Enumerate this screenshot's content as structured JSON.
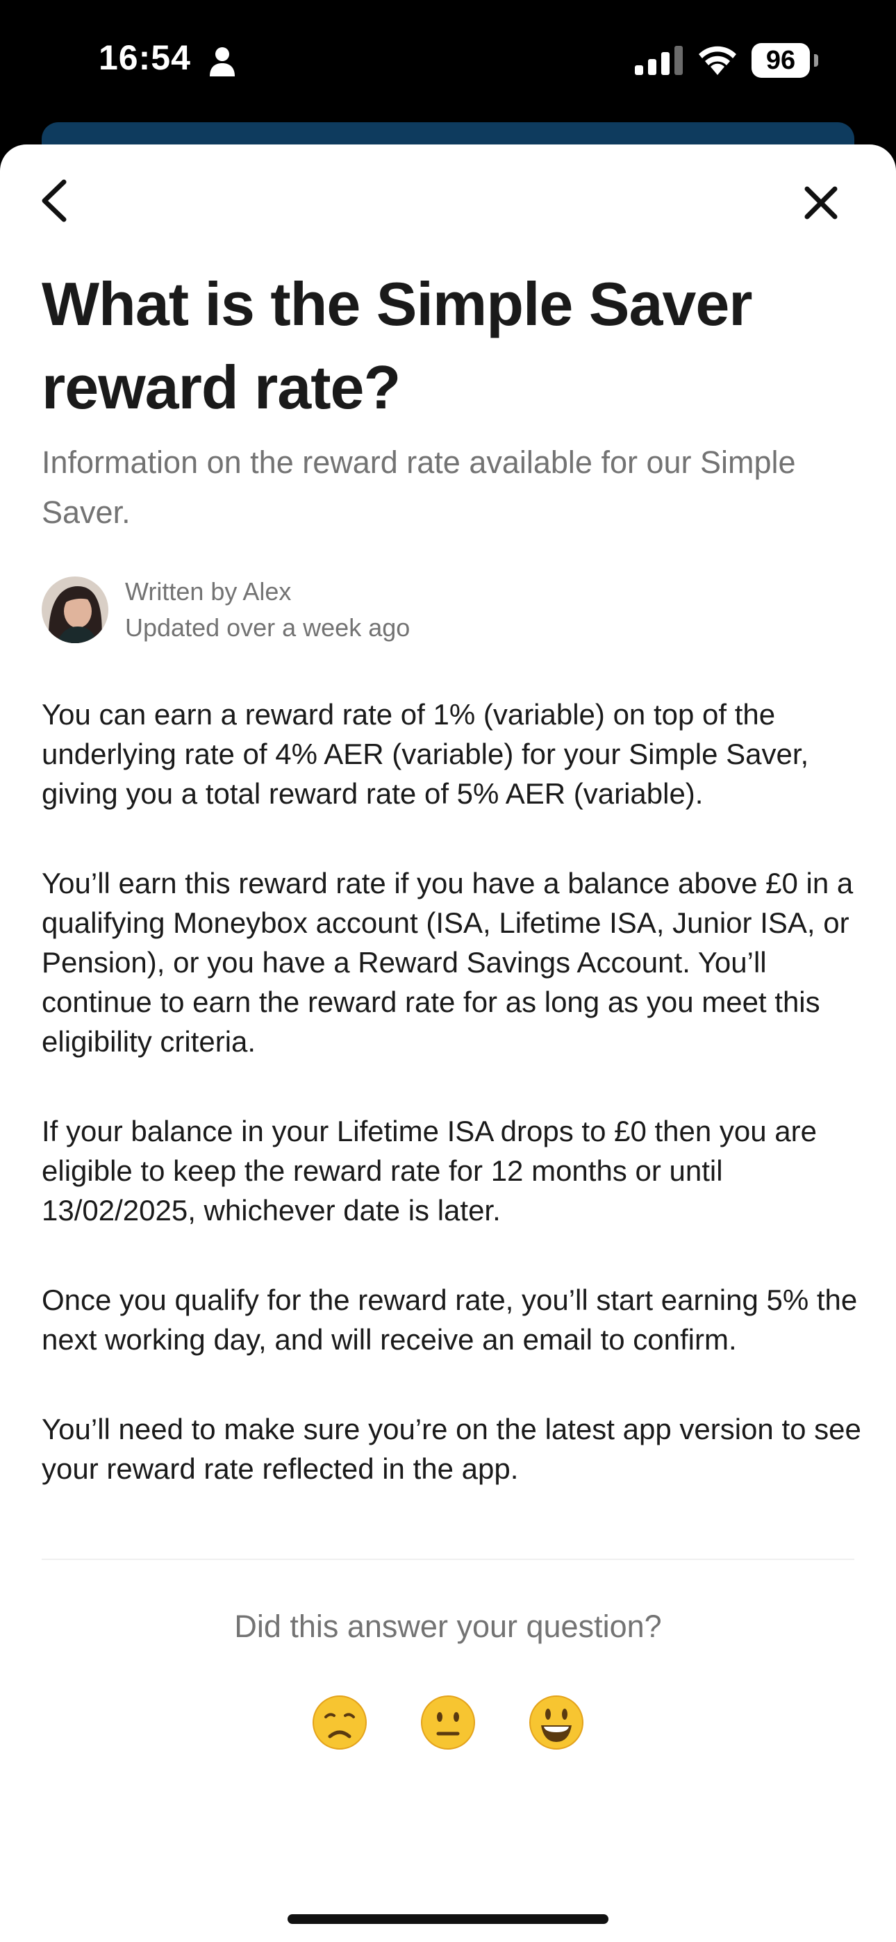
{
  "status_bar": {
    "time": "16:54",
    "battery": "96"
  },
  "article": {
    "title": "What is the Simple Saver reward rate?",
    "subtitle": "Information on the reward rate available for our Simple Saver.",
    "author_line": "Written by Alex",
    "updated_line": "Updated over a week ago",
    "paragraphs": [
      "You can earn a reward rate of 1% (variable) on top of the underlying rate of 4% AER (variable) for your Simple Saver, giving you a total reward rate of 5% AER (variable).",
      "You’ll earn this reward rate if you have a balance above £0 in a qualifying Moneybox account (ISA, Lifetime ISA, Junior ISA, or Pension), or you have a Reward Savings Account. You’ll continue to earn the reward rate for as long as you meet this eligibility criteria.",
      "If your balance in your Lifetime ISA drops to £0 then you are eligible to keep the reward rate for 12 months or until 13/02/2025, whichever date is later.",
      "Once you qualify for the reward rate, you’ll start earning 5% the next working day, and will receive an email to confirm.",
      "You’ll need to make sure you’re on the latest app version to see your reward rate reflected in the app."
    ]
  },
  "feedback": {
    "question": "Did this answer your question?",
    "reactions": [
      "disappointed-face-icon",
      "neutral-face-icon",
      "smiley-face-icon"
    ]
  },
  "colors": {
    "behind_card": "#0e3b5e",
    "text_primary": "#1a1a1a",
    "text_secondary": "#737373",
    "emoji_yellow": "#f7c531"
  }
}
